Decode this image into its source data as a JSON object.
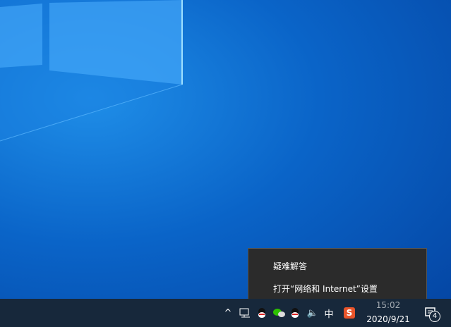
{
  "context_menu": {
    "items": [
      "疑难解答",
      "打开“网络和 Internet”设置"
    ]
  },
  "taskbar": {
    "time": "15:02",
    "date": "2020/9/21",
    "notification_count": "4",
    "ime": "中",
    "sogou": "S"
  }
}
